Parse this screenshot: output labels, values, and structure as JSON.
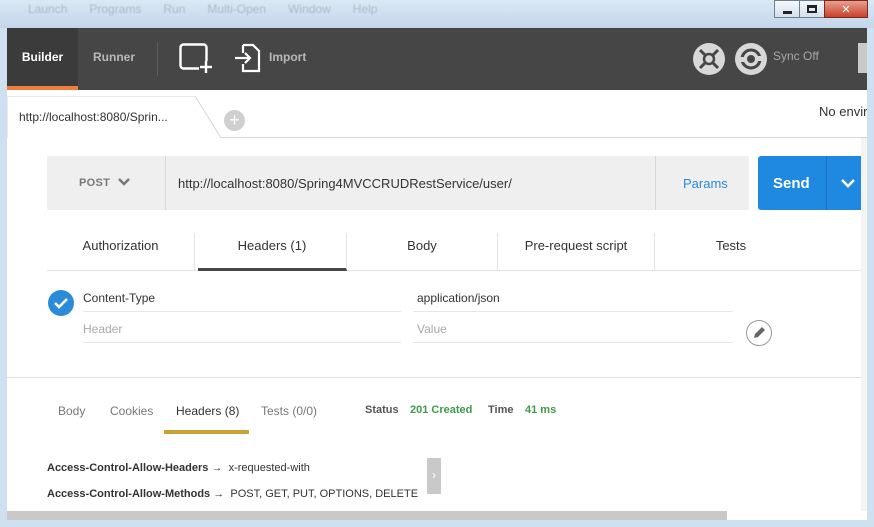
{
  "window": {
    "menu": [
      "Launch",
      "Programs",
      "Run",
      "Multi-Open",
      "Window",
      "Help"
    ]
  },
  "topbar": {
    "builder_label": "Builder",
    "runner_label": "Runner",
    "import_label": "Import",
    "sync_label": "Sync Off",
    "accent_color": "#f07d3c"
  },
  "tabs": {
    "request_tab_label": "http://localhost:8080/Sprin...",
    "environment_label": "No envir"
  },
  "request": {
    "method": "POST",
    "url": "http://localhost:8080/Spring4MVCCRUDRestService/user/",
    "params_label": "Params",
    "send_label": "Send",
    "send_color": "#1f88e0",
    "subtabs": [
      "Authorization",
      "Headers (1)",
      "Body",
      "Pre-request script",
      "Tests"
    ],
    "active_subtab": "Headers (1)"
  },
  "headers": {
    "rows": [
      {
        "key": "Content-Type",
        "value": "application/json",
        "enabled": true
      }
    ],
    "key_placeholder": "Header",
    "value_placeholder": "Value"
  },
  "response": {
    "tabs": [
      "Body",
      "Cookies",
      "Headers (8)",
      "Tests (0/0)"
    ],
    "active_tab": "Headers (8)",
    "status_label": "Status",
    "status_value": "201 Created",
    "time_label": "Time",
    "time_value": "41 ms",
    "status_color": "#3f9a4a",
    "headers": [
      {
        "name": "Access-Control-Allow-Headers",
        "arrow": "→",
        "value": "x-requested-with"
      },
      {
        "name": "Access-Control-Allow-Methods",
        "arrow": "→",
        "value": "POST, GET, PUT, OPTIONS, DELETE"
      }
    ]
  }
}
